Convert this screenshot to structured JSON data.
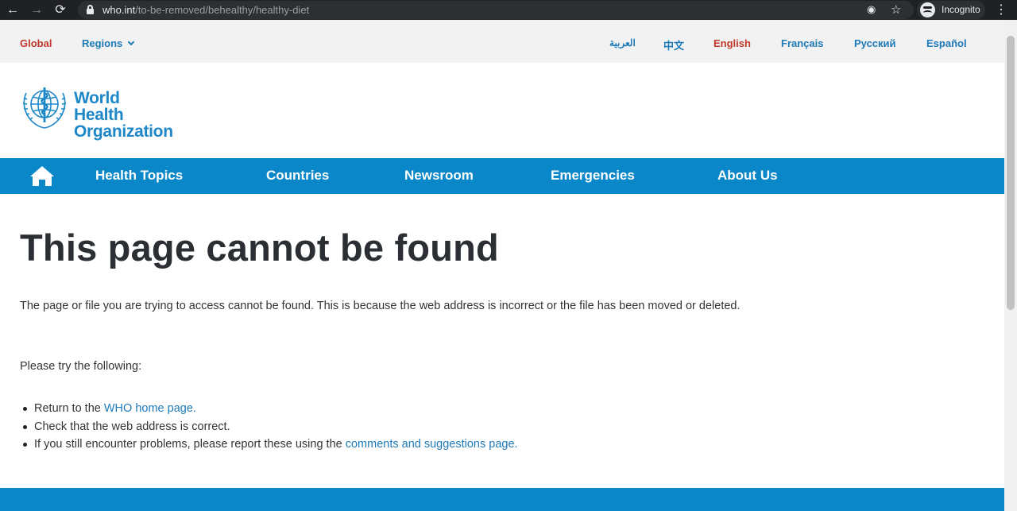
{
  "browser": {
    "url_host": "who.int",
    "url_path": "/to-be-removed/behealthy/healthy-diet",
    "incognito_label": "Incognito"
  },
  "topbar": {
    "global": "Global",
    "regions": "Regions",
    "languages": [
      "العربية",
      "中文",
      "English",
      "Français",
      "Русский",
      "Español"
    ],
    "active_language": "English"
  },
  "logo": {
    "line1": "World Health",
    "line2": "Organization"
  },
  "nav": {
    "items": [
      "Health Topics",
      "Countries",
      "Newsroom",
      "Emergencies",
      "About Us"
    ]
  },
  "content": {
    "title": "This page cannot be found",
    "intro": "The page or file you are trying to access cannot be found. This is because the web address is incorrect or the file has been moved or deleted.",
    "try_heading": "Please try the following:",
    "item1_prefix": "Return to the ",
    "item1_link": "WHO home page.",
    "item2": "Check that the web address is correct.",
    "item3_prefix": "If you still encounter problems, please report these using the ",
    "item3_link": "comments and suggestions page."
  },
  "colors": {
    "brand_blue": "#0a87c9",
    "link_blue": "#1d7ab8",
    "active_red": "#c0392b"
  }
}
